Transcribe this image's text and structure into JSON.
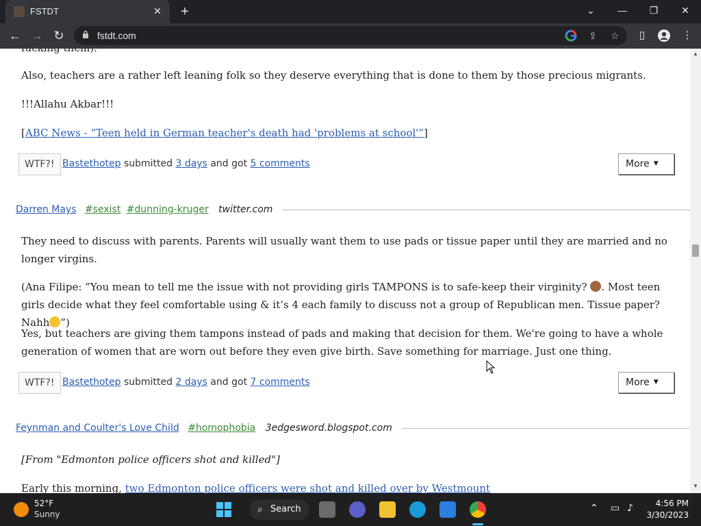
{
  "browser": {
    "tab_title": "FSTDT",
    "url": "fstdt.com",
    "close_tab_glyph": "✕",
    "new_tab_glyph": "+"
  },
  "page": {
    "cut_line": "fucking them).",
    "post1": {
      "paragraphs": [
        "Also, teachers are a rather left leaning folk so they deserve everything that is done to them by those precious migrants.",
        "!!!Allahu Akbar!!!"
      ],
      "link_open": "[",
      "link_text": "ABC News - “Teen held in German teacher's death had 'problems at school'”",
      "link_close": "]",
      "wtf_label": "WTF?!",
      "submitter": "Bastethotep",
      "submitted_word": "submitted",
      "age": "3 days",
      "and_got": "and got",
      "comments": "5 comments",
      "more_label": "More"
    },
    "post2": {
      "author": "Darren Mays",
      "tags": [
        "#sexist",
        "#dunning-kruger"
      ],
      "source": "twitter.com",
      "p1": "They need to discuss with parents. Parents will usually want them to use pads or tissue paper until they are married and no longer virgins.",
      "p2a": "(Ana Filipe: ”You mean to tell me the issue with not providing girls TAMPONS is to safe-keep their virginity?",
      "p2b": ". Most teen girls decide what they feel comfortable using & it’s 4 each family to discuss not a group of Republican men. Tissue paper? Nahh",
      "p2c": "”)",
      "p3": "Yes, but teachers are giving them tampons instead of pads and making that decision for them. We're going to have a whole generation of women that are worn out before they even give birth. Save something for marriage. Just one thing.",
      "wtf_label": "WTF?!",
      "submitter": "Bastethotep",
      "submitted_word": "submitted",
      "age": "2 days",
      "and_got": "and got",
      "comments": "7 comments",
      "more_label": "More"
    },
    "post3": {
      "author": "Feynman and Coulter's Love Child",
      "tag": "#homophobia",
      "source": "3edgesword.blogspot.com",
      "p1": "[From \"Edmonton police officers shot and killed\"]",
      "p2_text": "Early this morning, ",
      "p2_link": "two Edmonton police officers were shot and killed over by Westmount"
    }
  },
  "taskbar": {
    "temperature": "52°F",
    "condition": "Sunny",
    "search_label": "Search",
    "time": "4:56 PM",
    "date": "3/30/2023"
  }
}
